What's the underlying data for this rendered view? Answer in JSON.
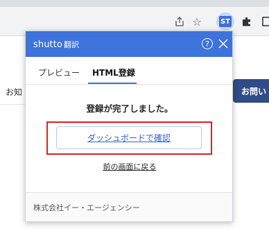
{
  "browser": {
    "toolbar_icons": [
      "share-icon",
      "star-icon",
      "shutto-extension-icon",
      "puzzle-icon",
      "window-icon"
    ],
    "extension_badge": "ST"
  },
  "page": {
    "left_link_partial": "お知",
    "contact_button_partial": "お問い"
  },
  "popup": {
    "brand": "shutto",
    "brand_sub": "翻訳",
    "help_symbol": "?",
    "tabs": [
      {
        "label": "プレビュー",
        "active": false
      },
      {
        "label": "HTML登録",
        "active": true
      }
    ],
    "message": "登録が完了しました。",
    "dashboard_button": "ダッシュボードで確認",
    "back_link": "前の画面に戻る",
    "footer_company": "株式会社イー・エージェンシー"
  },
  "colors": {
    "header_blue": "#3e73dc",
    "highlight_red": "#e0201b",
    "link_blue": "#2f5fcf",
    "contact_navy": "#2f4b88"
  }
}
